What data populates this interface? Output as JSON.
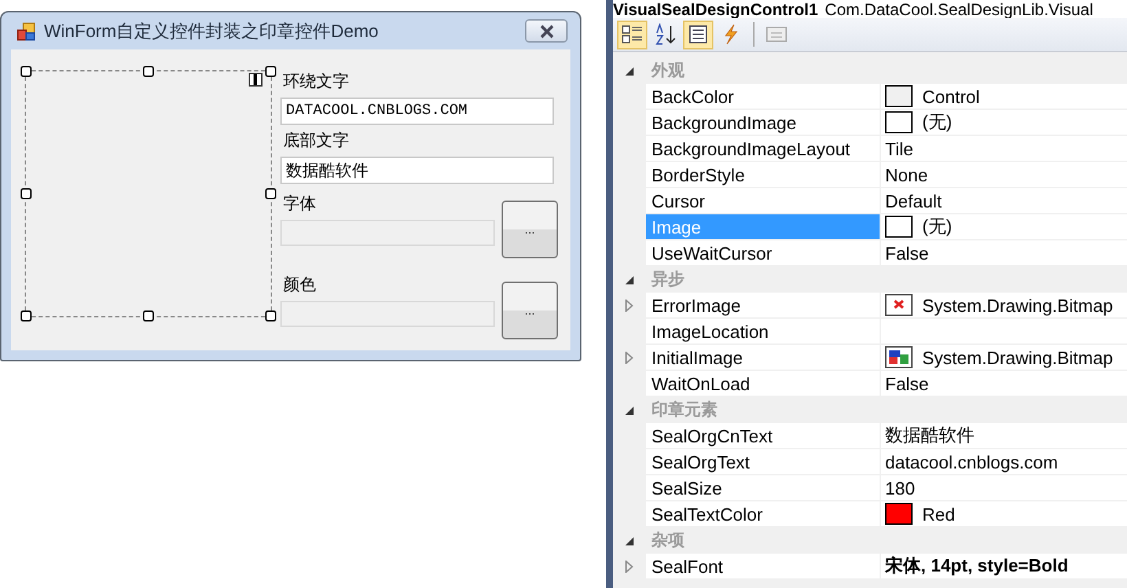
{
  "form_window": {
    "title": "WinForm自定义控件封装之印章控件Demo",
    "fields": [
      {
        "label": "环绕文字",
        "value": "DATACOOL.CNBLOGS.COM",
        "disabled": false,
        "has_button": false,
        "mono": true
      },
      {
        "label": "底部文字",
        "value": "数据酷软件",
        "disabled": false,
        "has_button": false,
        "mono": false
      },
      {
        "label": "字体",
        "disabled": true,
        "has_button": true,
        "button": "...",
        "mono": false
      },
      {
        "label": "颜色",
        "disabled": true,
        "has_button": true,
        "button": "...",
        "mono": false
      }
    ]
  },
  "property_grid": {
    "object_name": "VisualSealDesignControl1",
    "type_name": "Com.DataCool.SealDesignLib.Visual",
    "toolbar": [
      {
        "kind": "categorized",
        "selected": true
      },
      {
        "kind": "alphabetical",
        "selected": false
      },
      {
        "kind": "properties",
        "selected": true
      },
      {
        "kind": "events",
        "selected": false
      },
      {
        "kind": "pages",
        "selected": false
      }
    ],
    "categories": [
      {
        "name": "外观",
        "expanded": true,
        "properties": [
          {
            "name": "BackColor",
            "value": "Control",
            "kind": "color",
            "color": "#f0f0f0",
            "selected": false,
            "expandable": false,
            "modified": false
          },
          {
            "name": "BackgroundImage",
            "value": "(无)",
            "kind": "empty-image",
            "selected": false,
            "expandable": false,
            "modified": false
          },
          {
            "name": "BackgroundImageLayout",
            "value": "Tile",
            "kind": "text",
            "selected": false,
            "expandable": false,
            "modified": false
          },
          {
            "name": "BorderStyle",
            "value": "None",
            "kind": "text",
            "selected": false,
            "expandable": false,
            "modified": false
          },
          {
            "name": "Cursor",
            "value": "Default",
            "kind": "text",
            "selected": false,
            "expandable": false,
            "modified": false
          },
          {
            "name": "Image",
            "value": "(无)",
            "kind": "empty-image",
            "selected": true,
            "expandable": false,
            "modified": false
          },
          {
            "name": "UseWaitCursor",
            "value": "False",
            "kind": "text",
            "selected": false,
            "expandable": false,
            "modified": false
          }
        ]
      },
      {
        "name": "异步",
        "expanded": true,
        "properties": [
          {
            "name": "ErrorImage",
            "value": "System.Drawing.Bitmap",
            "kind": "error-image",
            "selected": false,
            "expandable": true,
            "modified": false
          },
          {
            "name": "ImageLocation",
            "kind": "text",
            "selected": false,
            "expandable": false
          },
          {
            "name": "InitialImage",
            "value": "System.Drawing.Bitmap",
            "kind": "bitmap",
            "selected": false,
            "expandable": true,
            "modified": false
          },
          {
            "name": "WaitOnLoad",
            "value": "False",
            "kind": "text",
            "selected": false,
            "expandable": false,
            "modified": false
          }
        ]
      },
      {
        "name": "印章元素",
        "expanded": true,
        "properties": [
          {
            "name": "SealOrgCnText",
            "value": "数据酷软件",
            "kind": "text",
            "selected": false,
            "expandable": false,
            "modified": false
          },
          {
            "name": "SealOrgText",
            "value": "datacool.cnblogs.com",
            "kind": "text",
            "selected": false,
            "expandable": false,
            "modified": false
          },
          {
            "name": "SealSize",
            "value": "180",
            "kind": "text",
            "selected": false,
            "expandable": false,
            "modified": false
          },
          {
            "name": "SealTextColor",
            "value": "Red",
            "kind": "color",
            "color": "#ff0000",
            "selected": false,
            "expandable": false,
            "modified": false
          }
        ]
      },
      {
        "name": "杂项",
        "expanded": true,
        "properties": [
          {
            "name": "SealFont",
            "value": "宋体, 14pt, style=Bold",
            "kind": "text",
            "selected": false,
            "expandable": true,
            "modified": true
          }
        ]
      }
    ]
  }
}
